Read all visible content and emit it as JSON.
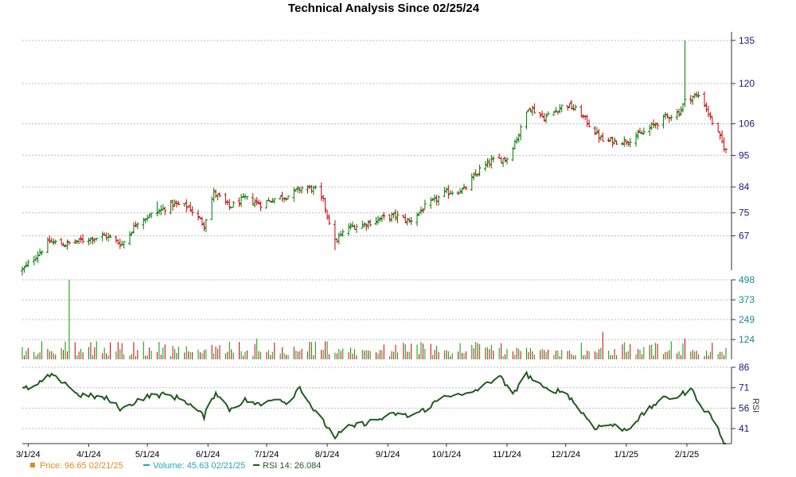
{
  "chart_data": {
    "title": "Technical Analysis Since 02/25/24",
    "type": "ohlc",
    "x_ticks": [
      "3/1/24",
      "4/1/24",
      "5/1/24",
      "6/1/24",
      "7/1/24",
      "8/1/24",
      "9/1/24",
      "10/1/24",
      "11/1/24",
      "12/1/24",
      "1/1/25",
      "2/1/25"
    ],
    "x_tick_dates": [
      "2024-03-01",
      "2024-04-01",
      "2024-05-01",
      "2024-06-01",
      "2024-07-01",
      "2024-08-01",
      "2024-09-01",
      "2024-10-01",
      "2024-11-01",
      "2024-12-01",
      "2025-01-01",
      "2025-02-01"
    ],
    "x_start": "2024-02-27",
    "x_end": "2025-02-21",
    "price_panel": {
      "y_ticks": [
        "135",
        "120",
        "106",
        "95",
        "84",
        "75",
        "67"
      ],
      "y_values": [
        135,
        120,
        106,
        95,
        84,
        75,
        67
      ],
      "ylim": [
        55,
        138
      ],
      "color_up": "#007700",
      "color_down": "#cc0000",
      "anchors": [
        [
          "2024-02-27",
          55
        ],
        [
          "2024-03-05",
          60
        ],
        [
          "2024-03-12",
          65
        ],
        [
          "2024-03-20",
          64
        ],
        [
          "2024-04-01",
          66
        ],
        [
          "2024-04-10",
          67
        ],
        [
          "2024-04-18",
          64
        ],
        [
          "2024-04-26",
          72
        ],
        [
          "2024-05-08",
          76
        ],
        [
          "2024-05-14",
          78
        ],
        [
          "2024-05-22",
          77
        ],
        [
          "2024-05-30",
          71
        ],
        [
          "2024-06-04",
          82
        ],
        [
          "2024-06-12",
          77
        ],
        [
          "2024-06-20",
          80
        ],
        [
          "2024-06-28",
          78
        ],
        [
          "2024-07-05",
          80
        ],
        [
          "2024-07-12",
          81
        ],
        [
          "2024-07-20",
          84
        ],
        [
          "2024-07-26",
          83
        ],
        [
          "2024-07-30",
          79
        ],
        [
          "2024-08-05",
          65
        ],
        [
          "2024-08-12",
          70
        ],
        [
          "2024-08-20",
          71
        ],
        [
          "2024-08-28",
          73
        ],
        [
          "2024-09-05",
          74
        ],
        [
          "2024-09-12",
          72
        ],
        [
          "2024-09-20",
          77
        ],
        [
          "2024-10-01",
          82
        ],
        [
          "2024-10-10",
          83
        ],
        [
          "2024-10-18",
          90
        ],
        [
          "2024-10-24",
          93
        ],
        [
          "2024-11-01",
          94
        ],
        [
          "2024-11-08",
          104
        ],
        [
          "2024-11-12",
          112
        ],
        [
          "2024-11-20",
          108
        ],
        [
          "2024-12-01",
          113
        ],
        [
          "2024-12-08",
          110
        ],
        [
          "2024-12-15",
          104
        ],
        [
          "2024-12-20",
          100
        ],
        [
          "2025-01-01",
          100
        ],
        [
          "2025-01-10",
          103
        ],
        [
          "2025-01-20",
          108
        ],
        [
          "2025-01-28",
          110
        ],
        [
          "2025-02-01",
          115
        ],
        [
          "2025-02-08",
          116
        ],
        [
          "2025-02-13",
          108
        ],
        [
          "2025-02-21",
          96.65
        ]
      ],
      "spikes": [
        [
          "2024-05-06",
          79
        ],
        [
          "2024-08-05",
          62
        ],
        [
          "2024-09-30",
          84
        ],
        [
          "2025-01-31",
          135
        ]
      ]
    },
    "volume_panel": {
      "y_ticks": [
        "498",
        "373",
        "249",
        "124"
      ],
      "y_values": [
        498,
        373,
        249,
        124
      ],
      "ylim": [
        0,
        498
      ],
      "spikes": [
        [
          "2024-03-22",
          498
        ],
        [
          "2024-06-26",
          130
        ],
        [
          "2024-12-20",
          170
        ],
        [
          "2025-01-31",
          130
        ]
      ]
    },
    "rsi_panel": {
      "y_ticks": [
        "86",
        "71",
        "56",
        "41"
      ],
      "y_values": [
        86,
        71,
        56,
        41
      ],
      "ylim": [
        30,
        86
      ],
      "label": "RSI",
      "color": "#1f5c1f",
      "anchors": [
        [
          "2024-02-27",
          70
        ],
        [
          "2024-03-05",
          72
        ],
        [
          "2024-03-12",
          80
        ],
        [
          "2024-03-20",
          75
        ],
        [
          "2024-03-26",
          66
        ],
        [
          "2024-04-02",
          65
        ],
        [
          "2024-04-10",
          63
        ],
        [
          "2024-04-18",
          55
        ],
        [
          "2024-04-26",
          62
        ],
        [
          "2024-05-02",
          65
        ],
        [
          "2024-05-10",
          66
        ],
        [
          "2024-05-20",
          62
        ],
        [
          "2024-05-30",
          50
        ],
        [
          "2024-06-05",
          68
        ],
        [
          "2024-06-12",
          55
        ],
        [
          "2024-06-20",
          62
        ],
        [
          "2024-06-28",
          58
        ],
        [
          "2024-07-05",
          64
        ],
        [
          "2024-07-12",
          60
        ],
        [
          "2024-07-18",
          72
        ],
        [
          "2024-07-25",
          55
        ],
        [
          "2024-08-05",
          35
        ],
        [
          "2024-08-12",
          42
        ],
        [
          "2024-08-20",
          45
        ],
        [
          "2024-08-28",
          48
        ],
        [
          "2024-09-05",
          52
        ],
        [
          "2024-09-12",
          50
        ],
        [
          "2024-09-20",
          55
        ],
        [
          "2024-10-01",
          66
        ],
        [
          "2024-10-10",
          65
        ],
        [
          "2024-10-20",
          72
        ],
        [
          "2024-10-28",
          80
        ],
        [
          "2024-11-04",
          65
        ],
        [
          "2024-11-10",
          82
        ],
        [
          "2024-11-20",
          70
        ],
        [
          "2024-12-01",
          68
        ],
        [
          "2024-12-08",
          55
        ],
        [
          "2024-12-16",
          42
        ],
        [
          "2024-12-24",
          44
        ],
        [
          "2025-01-01",
          40
        ],
        [
          "2025-01-10",
          52
        ],
        [
          "2025-01-18",
          62
        ],
        [
          "2025-01-28",
          65
        ],
        [
          "2025-02-03",
          70
        ],
        [
          "2025-02-10",
          55
        ],
        [
          "2025-02-15",
          48
        ],
        [
          "2025-02-21",
          26.084
        ]
      ]
    },
    "legend": [
      {
        "text": "Price: 96.65  02/21/25",
        "color": "#e08a1e",
        "marker": "square"
      },
      {
        "text": "Volume: 45.63  02/21/25",
        "color": "#22a8b4",
        "marker": "dash"
      },
      {
        "text": "RSI 14: 26.084",
        "color": "#1f5c1f",
        "marker": "line"
      }
    ]
  }
}
